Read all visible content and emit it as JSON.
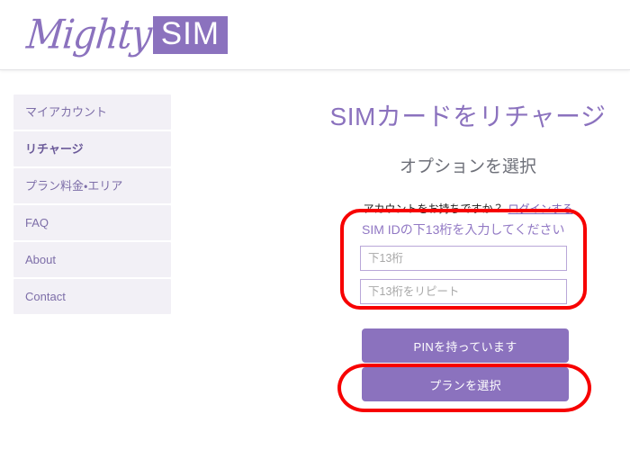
{
  "header": {
    "logo_text_script": "Mighty",
    "logo_text_badge": "SIM",
    "brand_color": "#8b72be"
  },
  "sidebar": {
    "items": [
      {
        "label": "マイアカウント",
        "active": false,
        "name": "sidebar-item-my-account"
      },
      {
        "label": "リチャージ",
        "active": true,
        "name": "sidebar-item-recharge"
      },
      {
        "label": "プラン料金・エリア",
        "active": false,
        "name": "sidebar-item-plans-pricing-area"
      },
      {
        "label": "FAQ",
        "active": false,
        "name": "sidebar-item-faq"
      },
      {
        "label": "About",
        "active": false,
        "name": "sidebar-item-about"
      },
      {
        "label": "Contact",
        "active": false,
        "name": "sidebar-item-contact"
      }
    ]
  },
  "main": {
    "title": "SIMカードをリチャージ",
    "subtitle": "オプションを選択",
    "account_question": "アカウントをお持ちですか？",
    "login_link": "ログインする",
    "simid": {
      "label": "SIM IDの下13桁を入力してください",
      "input1_value": "",
      "input1_placeholder": "下13桁",
      "input2_value": "",
      "input2_placeholder": "下13桁をリピート"
    },
    "buttons": {
      "pin": "PINを持っています",
      "plan": "プランを選択"
    }
  },
  "annotations": {
    "color": "#f70000",
    "simid_box": "highlight-simid-section",
    "plan_box": "highlight-select-plan-button"
  }
}
